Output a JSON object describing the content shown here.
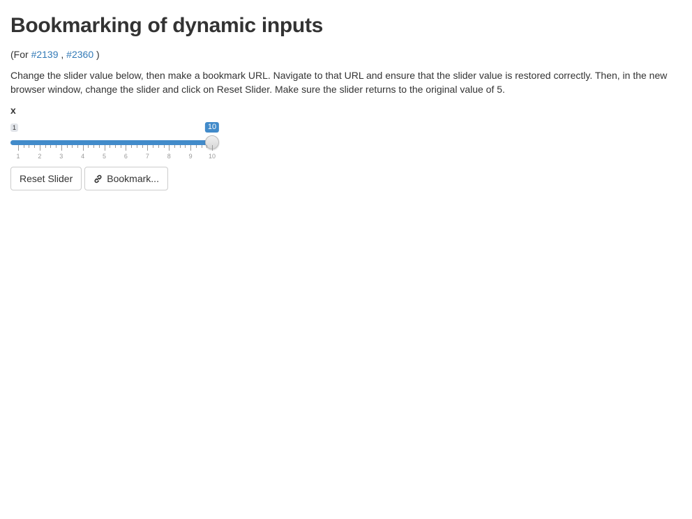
{
  "page": {
    "title": "Bookmarking of dynamic inputs",
    "refs_prefix": "(For",
    "refs_sep": ",",
    "refs_suffix": ")",
    "refs": [
      "#2139",
      "#2360"
    ],
    "description": "Change the slider value below, then make a bookmark URL. Navigate to that URL and ensure that the slider value is restored correctly. Then, in the new browser window, change the slider and click on Reset Slider. Make sure the slider returns to the original value of 5."
  },
  "slider": {
    "label": "x",
    "min": 1,
    "max": 10,
    "value": 10,
    "min_label": "1",
    "value_label": "10",
    "tick_labels": [
      "1",
      "2",
      "3",
      "4",
      "5",
      "6",
      "7",
      "8",
      "9",
      "10"
    ]
  },
  "buttons": {
    "reset_label": "Reset Slider",
    "bookmark_label": "Bookmark..."
  },
  "colors": {
    "accent": "#428bca",
    "link": "#337ab7"
  },
  "icons": {
    "bookmark": "link-icon"
  }
}
